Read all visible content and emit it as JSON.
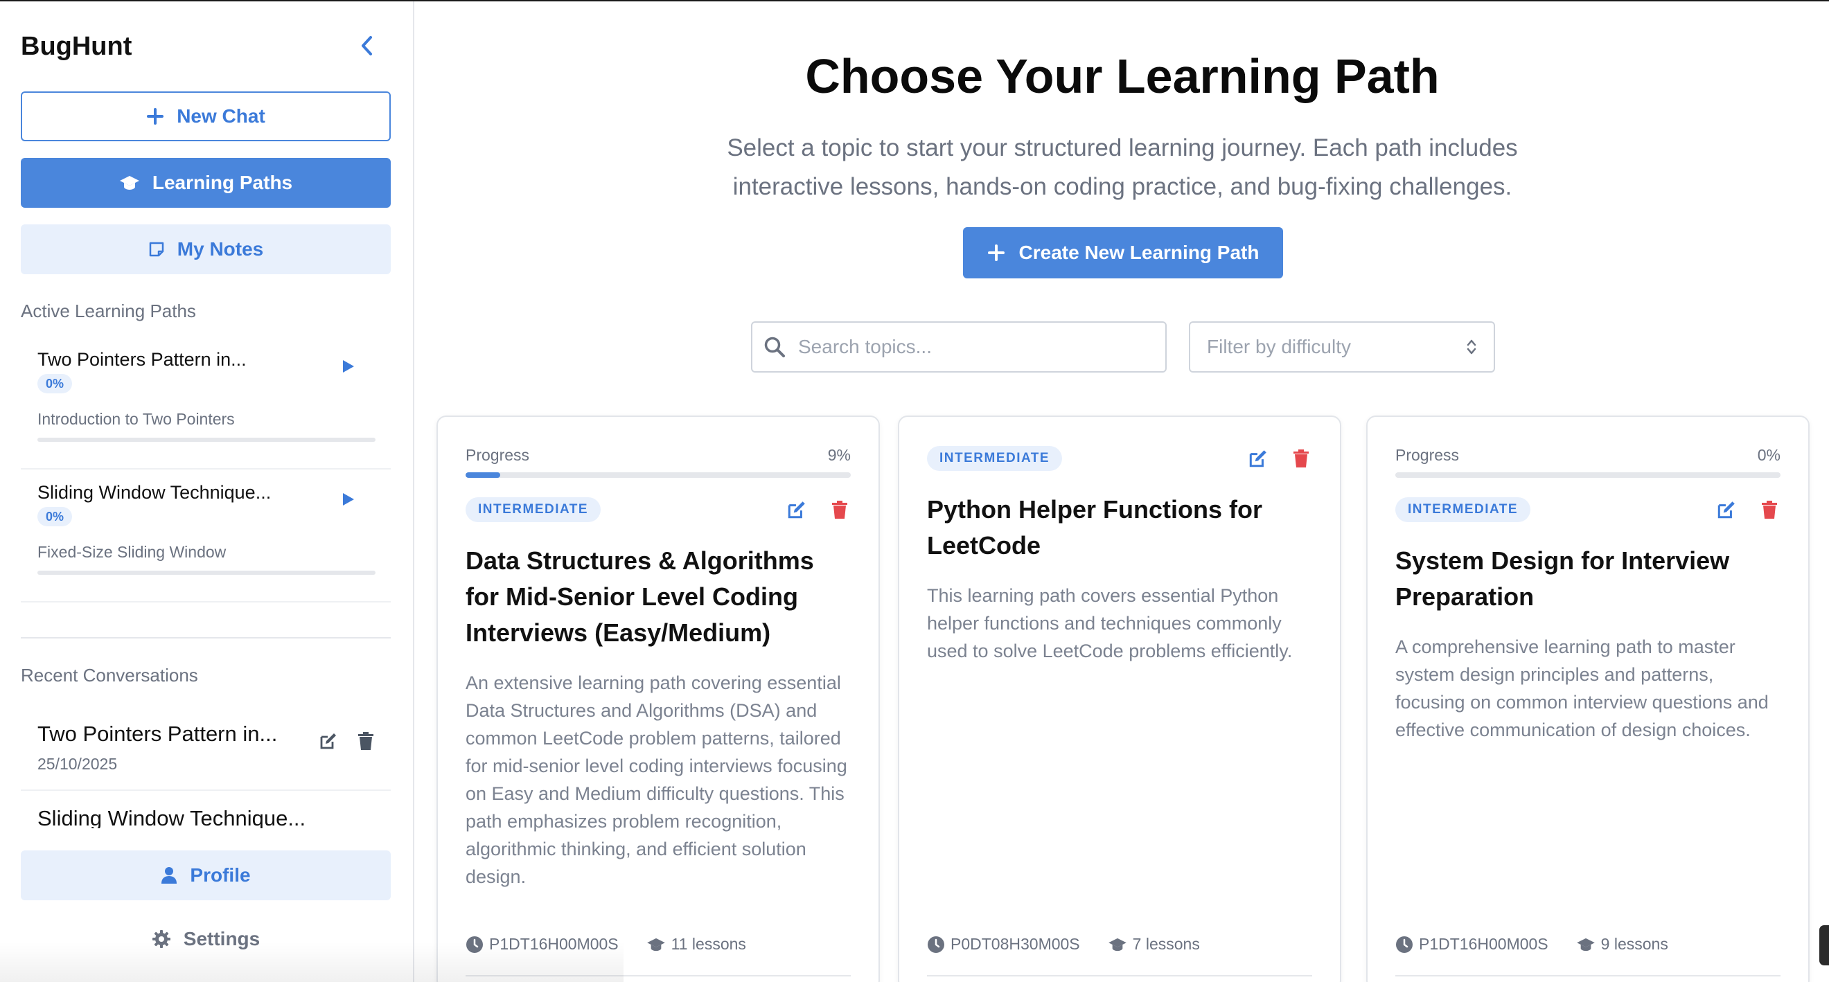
{
  "sidebar": {
    "brand": "BugHunt",
    "new_chat_label": "New Chat",
    "learning_paths_label": "Learning Paths",
    "my_notes_label": "My Notes",
    "active_section_label": "Active Learning Paths",
    "active_paths": [
      {
        "title": "Two Pointers Pattern in...",
        "progress": "0%",
        "current_lesson": "Introduction to Two Pointers"
      },
      {
        "title": "Sliding Window Technique...",
        "progress": "0%",
        "current_lesson": "Fixed-Size Sliding Window"
      }
    ],
    "recent_section_label": "Recent Conversations",
    "conversations": [
      {
        "title": "Two Pointers Pattern in...",
        "date": "25/10/2025"
      },
      {
        "title": "Sliding Window Technique...",
        "date": ""
      }
    ],
    "profile_label": "Profile",
    "settings_label": "Settings"
  },
  "main": {
    "title": "Choose Your Learning Path",
    "subtitle": "Select a topic to start your structured learning journey. Each path includes interactive lessons, hands-on coding practice, and bug-fixing challenges.",
    "create_label": "Create New Learning Path",
    "search_placeholder": "Search topics...",
    "filter_placeholder": "Filter by difficulty",
    "progress_label": "Progress",
    "cards": [
      {
        "has_progress": true,
        "progress_text": "9%",
        "progress_fraction": 0.09,
        "level": "INTERMEDIATE",
        "title": "Data Structures & Algorithms for Mid-Senior Level Coding Interviews (Easy/Medium)",
        "description": "An extensive learning path covering essential Data Structures and Algorithms (DSA) and common LeetCode problem patterns, tailored for mid-senior level coding interviews focusing on Easy and Medium difficulty questions. This path emphasizes problem recognition, algorithmic thinking, and efficient solution design.",
        "duration": "P1DT16H00M00S",
        "lessons": "11 lessons"
      },
      {
        "has_progress": false,
        "level": "INTERMEDIATE",
        "title": "Python Helper Functions for LeetCode",
        "description": "This learning path covers essential Python helper functions and techniques commonly used to solve LeetCode problems efficiently.",
        "duration": "P0DT08H30M00S",
        "lessons": "7 lessons"
      },
      {
        "has_progress": true,
        "progress_text": "0%",
        "progress_fraction": 0.0,
        "level": "INTERMEDIATE",
        "title": "System Design for Interview Preparation",
        "description": "A comprehensive learning path to master system design principles and patterns, focusing on common interview questions and effective communication of design choices.",
        "duration": "P1DT16H00M00S",
        "lessons": "9 lessons"
      }
    ]
  },
  "colors": {
    "accent": "#4a86dc",
    "accent_light": "#e8f0fc",
    "danger": "#e5484d",
    "muted": "#6b7280"
  },
  "icons": [
    "chevron-left-icon",
    "plus-icon",
    "graduation-cap-icon",
    "note-icon",
    "play-icon",
    "edit-icon",
    "trash-icon",
    "user-icon",
    "gear-icon",
    "search-icon",
    "select-arrows-icon",
    "clock-icon"
  ]
}
